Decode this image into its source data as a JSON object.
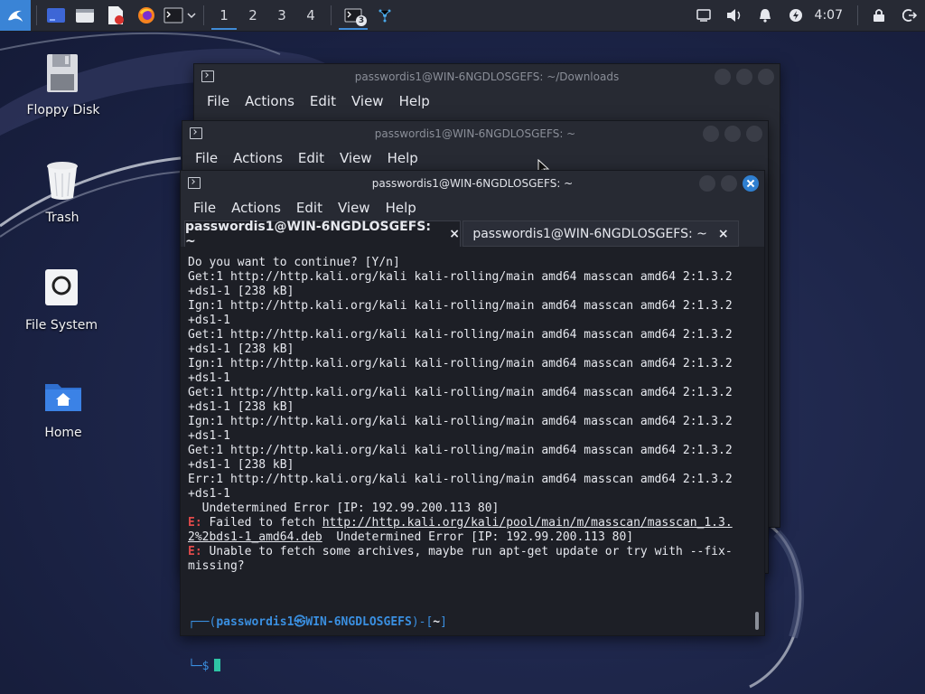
{
  "taskbar": {
    "workspaces": [
      "1",
      "2",
      "3",
      "4"
    ],
    "terminal_badge": "3",
    "clock": "4:07",
    "icons": {
      "menu": "kali-dragon-icon",
      "show_desktop": "show-desktop-icon",
      "files": "file-manager-icon",
      "editor": "text-editor-icon",
      "browser": "firefox-icon",
      "terminal": "terminal-icon",
      "dropdown": "chevron-down-icon",
      "network": "network-icon",
      "display": "display-icon",
      "volume": "volume-icon",
      "notifications": "bell-icon",
      "power": "power-manager-icon",
      "lock": "lock-icon",
      "logout": "logout-icon"
    }
  },
  "desktop": {
    "icons": [
      {
        "label": "Floppy Disk",
        "icon": "floppy-disk-icon"
      },
      {
        "label": "Trash",
        "icon": "trash-icon"
      },
      {
        "label": "File System",
        "icon": "file-system-icon"
      },
      {
        "label": "Home",
        "icon": "home-folder-icon"
      }
    ]
  },
  "windows": {
    "back": {
      "title": "passwordis1@WIN-6NGDLOSGEFS: ~/Downloads",
      "menu": [
        "File",
        "Actions",
        "Edit",
        "View",
        "Help"
      ]
    },
    "middle": {
      "title": "passwordis1@WIN-6NGDLOSGEFS: ~",
      "menu": [
        "File",
        "Actions",
        "Edit",
        "View",
        "Help"
      ]
    },
    "front": {
      "title": "passwordis1@WIN-6NGDLOSGEFS: ~",
      "menu": [
        "File",
        "Actions",
        "Edit",
        "View",
        "Help"
      ],
      "tabs": [
        {
          "label": "passwordis1@WIN-6NGDLOSGEFS: ~",
          "close": "×",
          "active": true
        },
        {
          "label": "passwordis1@WIN-6NGDLOSGEFS: ~",
          "close": "×",
          "active": false
        }
      ]
    }
  },
  "terminal": {
    "lines": [
      {
        "text": "Do you want to continue? [Y/n]"
      },
      {
        "text": "Get:1 http://http.kali.org/kali kali-rolling/main amd64 masscan amd64 2:1.3.2"
      },
      {
        "text": "+ds1-1 [238 kB]"
      },
      {
        "text": "Ign:1 http://http.kali.org/kali kali-rolling/main amd64 masscan amd64 2:1.3.2"
      },
      {
        "text": "+ds1-1"
      },
      {
        "text": "Get:1 http://http.kali.org/kali kali-rolling/main amd64 masscan amd64 2:1.3.2"
      },
      {
        "text": "+ds1-1 [238 kB]"
      },
      {
        "text": "Ign:1 http://http.kali.org/kali kali-rolling/main amd64 masscan amd64 2:1.3.2"
      },
      {
        "text": "+ds1-1"
      },
      {
        "text": "Get:1 http://http.kali.org/kali kali-rolling/main amd64 masscan amd64 2:1.3.2"
      },
      {
        "text": "+ds1-1 [238 kB]"
      },
      {
        "text": "Ign:1 http://http.kali.org/kali kali-rolling/main amd64 masscan amd64 2:1.3.2"
      },
      {
        "text": "+ds1-1"
      },
      {
        "text": "Get:1 http://http.kali.org/kali kali-rolling/main amd64 masscan amd64 2:1.3.2"
      },
      {
        "text": "+ds1-1 [238 kB]"
      },
      {
        "text": "Err:1 http://http.kali.org/kali kali-rolling/main amd64 masscan amd64 2:1.3.2"
      },
      {
        "text": "+ds1-1"
      },
      {
        "text": "  Undetermined Error [IP: 192.99.200.113 80]"
      },
      {
        "mark": "E:",
        "text": " Failed to fetch ",
        "url": "http://http.kali.org/kali/pool/main/m/masscan/masscan_1.3."
      },
      {
        "url": "2%2bds1-1_amd64.deb",
        "text": "  Undetermined Error [IP: 192.99.200.113 80]"
      },
      {
        "mark": "E:",
        "text": " Unable to fetch some archives, maybe run apt-get update or try with --fix-"
      },
      {
        "text": "missing?"
      }
    ],
    "prompt": {
      "frame_open": "┌──(",
      "user": "passwordis1㉿WIN-6NGDLOSGEFS",
      "frame_close": ")-[",
      "path": "~",
      "frame_end": "]",
      "line2": "└─$"
    }
  }
}
